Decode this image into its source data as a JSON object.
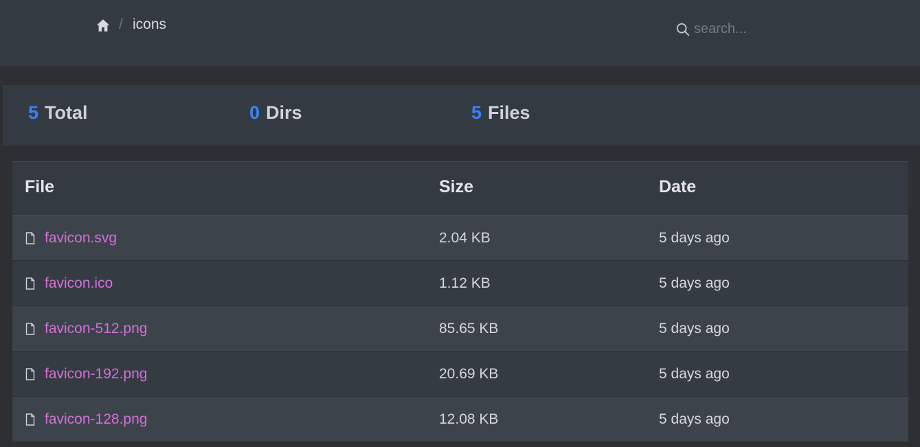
{
  "breadcrumb": {
    "separator": "/",
    "current": "icons",
    "home_icon": "home-icon"
  },
  "search": {
    "placeholder": "search...",
    "value": ""
  },
  "stats": {
    "total": {
      "count": "5",
      "label": "Total"
    },
    "dirs": {
      "count": "0",
      "label": "Dirs"
    },
    "files": {
      "count": "5",
      "label": "Files"
    }
  },
  "table": {
    "headers": {
      "file": "File",
      "size": "Size",
      "date": "Date"
    },
    "rows": [
      {
        "name": "favicon.svg",
        "size": "2.04 KB",
        "date": "5 days ago"
      },
      {
        "name": "favicon.ico",
        "size": "1.12 KB",
        "date": "5 days ago"
      },
      {
        "name": "favicon-512.png",
        "size": "85.65 KB",
        "date": "5 days ago"
      },
      {
        "name": "favicon-192.png",
        "size": "20.69 KB",
        "date": "5 days ago"
      },
      {
        "name": "favicon-128.png",
        "size": "12.08 KB",
        "date": "5 days ago"
      }
    ]
  },
  "colors": {
    "accent_number": "#3b82f6",
    "file_link": "#d46fd8",
    "background": "#2d2f33",
    "panel": "#343a42"
  }
}
